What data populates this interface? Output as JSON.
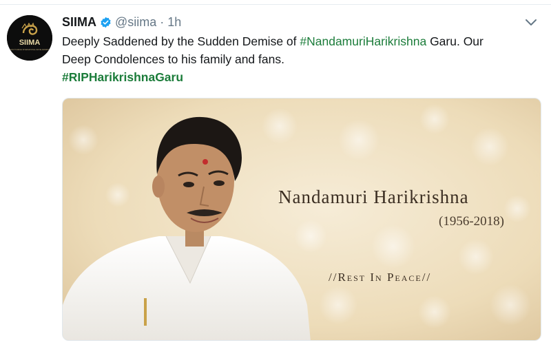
{
  "tweet": {
    "display_name": "SIIMA",
    "handle": "@siima",
    "separator": "·",
    "timestamp": "1h",
    "text_line1_pre": "Deeply Saddened by the Sudden Demise of ",
    "text_line1_hashtag": "#NandamuriHarikrishna",
    "text_line1_post": " Garu. Our",
    "text_line2": "Deep Condolences to his family and fans.",
    "text_line3_hashtag": "#RIPHarikrishnaGaru"
  },
  "avatar": {
    "logo_text": "SIIMA",
    "logo_subtext": "SOUTH INDIAN INTERNATIONAL MOVIE AWARDS"
  },
  "media": {
    "name": "Nandamuri Harikrishna",
    "years": "(1956-2018)",
    "message": "//Rest In Peace//"
  },
  "colors": {
    "hashtag": "#1b7c3a",
    "verified": "#1da1f2",
    "muted_text": "#657786",
    "card_background": "#efe1c2"
  },
  "icons": {
    "verified": "verified-badge-icon",
    "caret": "chevron-down-icon"
  }
}
